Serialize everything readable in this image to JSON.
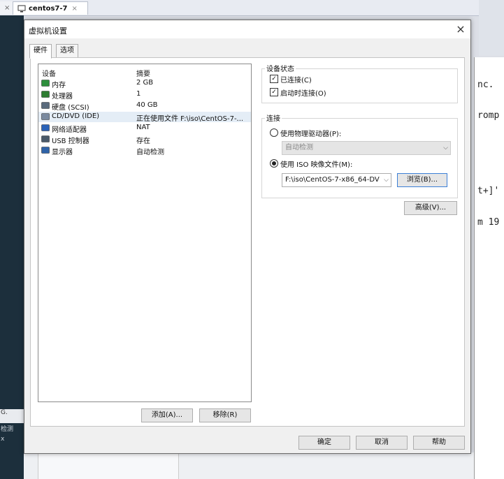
{
  "background": {
    "tab_left_close": "×",
    "tab_title": "centos7-7",
    "tab_close": "×",
    "terminal_lines": [
      "nc. ",
      "romp",
      "t+]'",
      "m 19"
    ],
    "left_panel_lines": [
      "G.",
      "检测",
      "x"
    ]
  },
  "dialog": {
    "title": "虚拟机设置",
    "close": "×",
    "tabs": [
      "硬件",
      "选项"
    ],
    "device_list": {
      "header_device": "设备",
      "header_summary": "摘要",
      "rows": [
        {
          "name": "内存",
          "summary": "2 GB",
          "icon": "memory-icon",
          "color": "#2d8f3c"
        },
        {
          "name": "处理器",
          "summary": "1",
          "icon": "processor-icon",
          "color": "#2e7d32"
        },
        {
          "name": "硬盘 (SCSI)",
          "summary": "40 GB",
          "icon": "hard-disk-icon",
          "color": "#5a6b7d"
        },
        {
          "name": "CD/DVD (IDE)",
          "summary": "正在使用文件 F:\\iso\\CentOS-7-...",
          "icon": "cd-dvd-icon",
          "color": "#7a8aa0",
          "selected": true
        },
        {
          "name": "网络适配器",
          "summary": "NAT",
          "icon": "network-adapter-icon",
          "color": "#2a62b8"
        },
        {
          "name": "USB 控制器",
          "summary": "存在",
          "icon": "usb-controller-icon",
          "color": "#4a5a6a"
        },
        {
          "name": "显示器",
          "summary": "自动检测",
          "icon": "display-icon",
          "color": "#2f63a8"
        }
      ]
    },
    "add_button": "添加(A)...",
    "remove_button": "移除(R)",
    "device_status": {
      "title": "设备状态",
      "connected": "已连接(C)",
      "connect_on_power": "启动时连接(O)"
    },
    "connection": {
      "title": "连接",
      "physical_drive": "使用物理驱动器(P):",
      "physical_drive_value": "自动检测",
      "iso_file": "使用 ISO 映像文件(M):",
      "iso_path": "F:\\iso\\CentOS-7-x86_64-DV",
      "browse": "浏览(B)..."
    },
    "advanced": "高级(V)...",
    "ok": "确定",
    "cancel": "取消",
    "help": "帮助"
  }
}
